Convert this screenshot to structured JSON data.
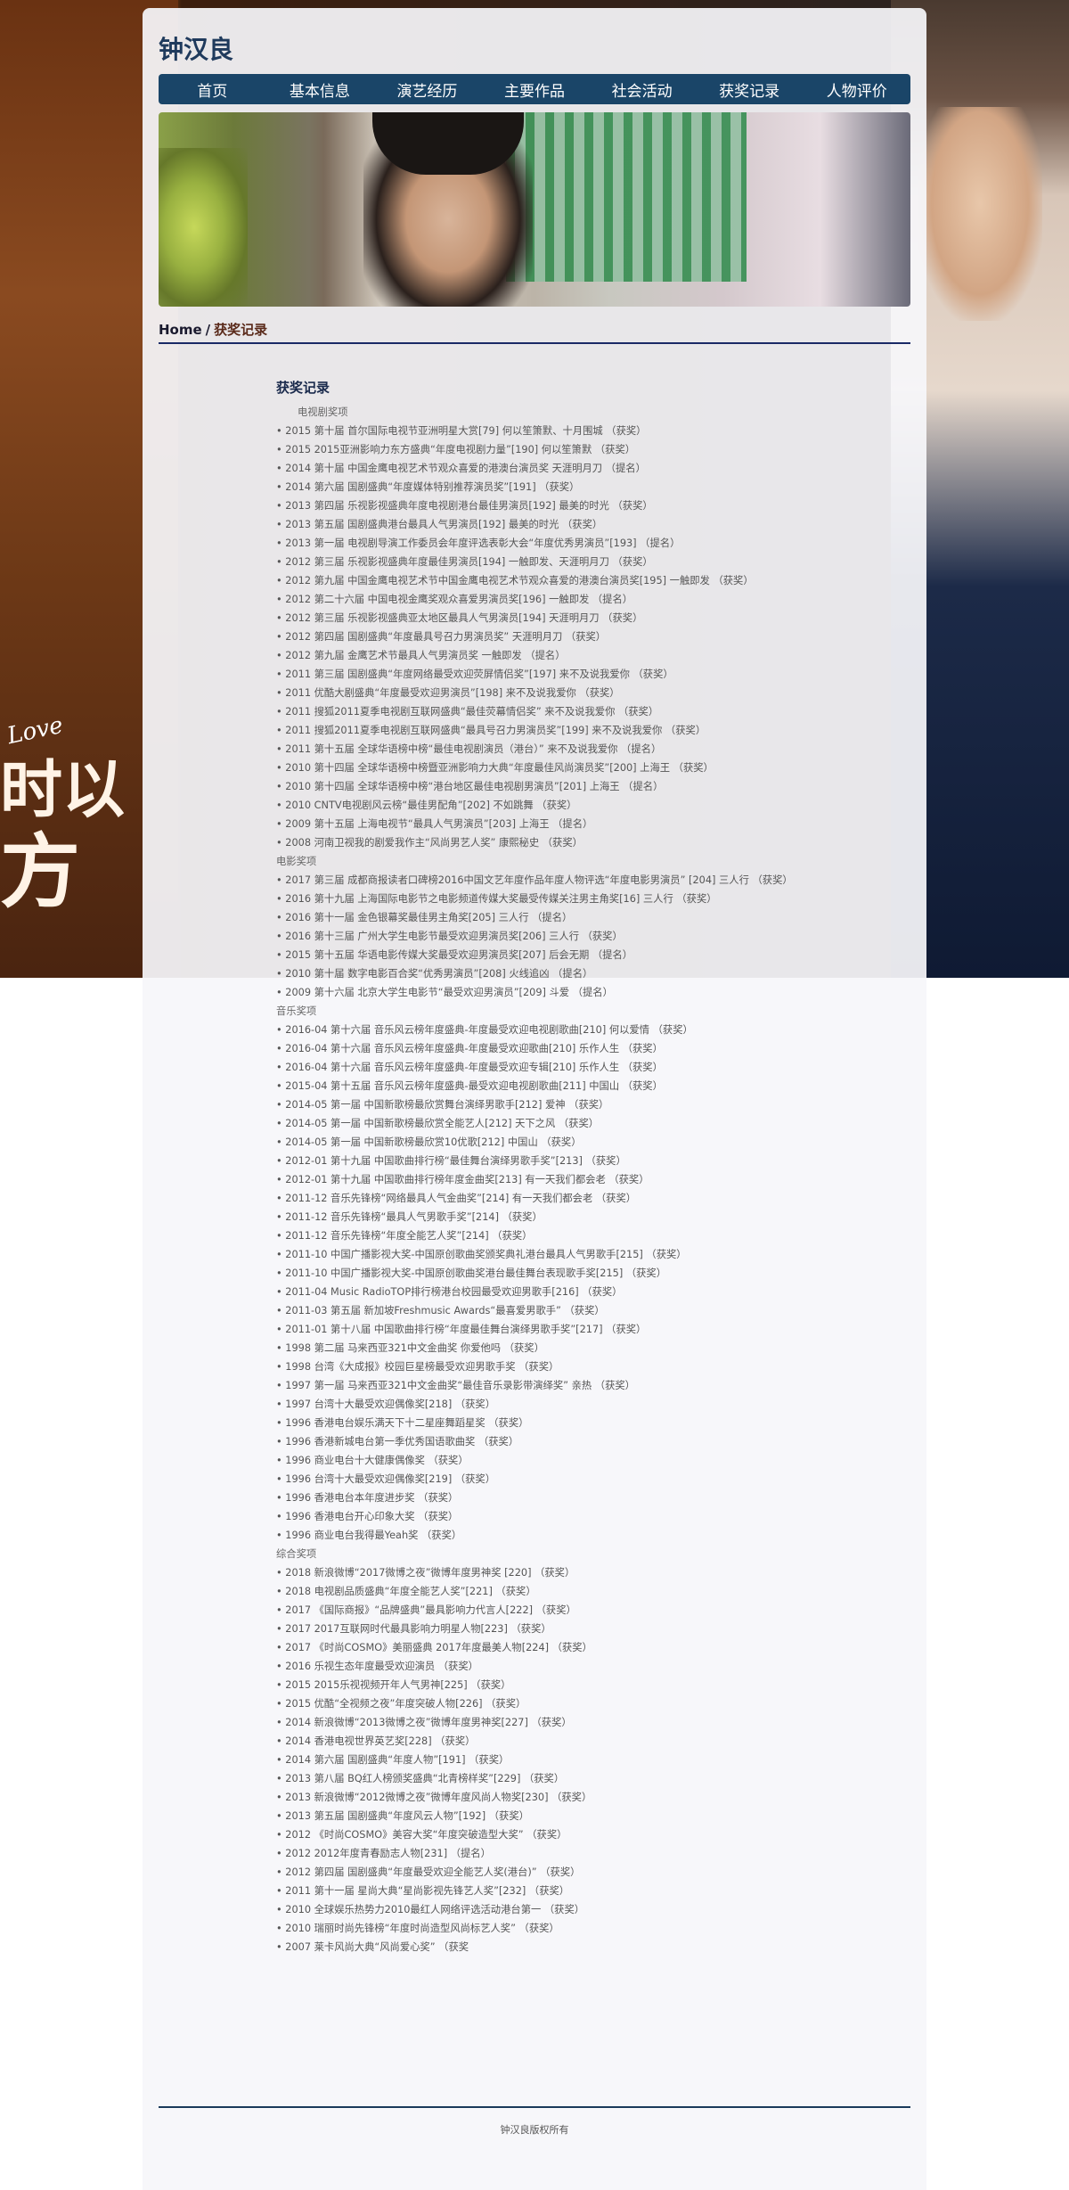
{
  "site": {
    "title": "钟汉良"
  },
  "nav": [
    "首页",
    "基本信息",
    "演艺经历",
    "主要作品",
    "社会活动",
    "获奖记录",
    "人物评价"
  ],
  "background": {
    "love_text": "Love",
    "big_char_1": "时以",
    "big_char_2": "方"
  },
  "breadcrumb": {
    "home": "Home",
    "sep": "/",
    "current": "获奖记录"
  },
  "section_title": "获奖记录",
  "categories": [
    {
      "name": "电视剧奖项",
      "indent": true,
      "items": [
        "2015 第十届 首尔国际电视节亚洲明星大赏[79] 何以笙箫默、十月围城 （获奖）",
        "2015 2015亚洲影响力东方盛典“年度电视剧力量”[190] 何以笙箫默 （获奖）",
        "2014 第十届 中国金鹰电视艺术节观众喜爱的港澳台演员奖 天涯明月刀 （提名）",
        "2014 第六届 国剧盛典“年度媒体特别推荐演员奖”[191] （获奖）",
        "2013 第四届 乐视影视盛典年度电视剧港台最佳男演员[192] 最美的时光 （获奖）",
        "2013 第五届 国剧盛典港台最具人气男演员[192] 最美的时光 （获奖）",
        "2013 第一届 电视剧导演工作委员会年度评选表彰大会“年度优秀男演员”[193] （提名）",
        "2012 第三届 乐视影视盛典年度最佳男演员[194] 一触即发、天涯明月刀 （获奖）",
        "2012 第九届 中国金鹰电视艺术节中国金鹰电视艺术节观众喜爱的港澳台演员奖[195] 一触即发 （获奖）",
        "2012 第二十六届 中国电视金鹰奖观众喜爱男演员奖[196] 一触即发 （提名）",
        "2012 第三届 乐视影视盛典亚太地区最具人气男演员[194] 天涯明月刀 （获奖）",
        "2012 第四届 国剧盛典“年度最具号召力男演员奖” 天涯明月刀 （获奖）",
        "2012 第九届 金鹰艺术节最具人气男演员奖 一触即发 （提名）",
        "2011 第三届 国剧盛典“年度网络最受欢迎荧屏情侣奖”[197] 来不及说我爱你 （获奖）",
        "2011 优酷大剧盛典“年度最受欢迎男演员”[198] 来不及说我爱你 （获奖）",
        "2011 搜狐2011夏季电视剧互联网盛典“最佳荧幕情侣奖” 来不及说我爱你 （获奖）",
        "2011 搜狐2011夏季电视剧互联网盛典“最具号召力男演员奖”[199] 来不及说我爱你 （获奖）",
        "2011 第十五届 全球华语榜中榜“最佳电视剧演员（港台）” 来不及说我爱你 （提名）",
        "2010 第十四届 全球华语榜中榜暨亚洲影响力大典“年度最佳风尚演员奖”[200] 上海王 （获奖）",
        "2010 第十四届 全球华语榜中榜“港台地区最佳电视剧男演员”[201] 上海王 （提名）",
        "2010 CNTV电视剧风云榜“最佳男配角”[202] 不如跳舞 （获奖）",
        "2009 第十五届 上海电视节“最具人气男演员”[203] 上海王 （提名）",
        "2008 河南卫视我的剧爱我作主“风尚男艺人奖” 康熙秘史 （获奖）"
      ]
    },
    {
      "name": "电影奖项",
      "indent": false,
      "items": [
        "2017 第三届 成都商报读者口碑榜2016中国文艺年度作品年度人物评选“年度电影男演员” [204] 三人行 （获奖）",
        "2016 第十九届 上海国际电影节之电影频道传媒大奖最受传媒关注男主角奖[16] 三人行 （获奖）",
        "2016 第十一届 金色银幕奖最佳男主角奖[205] 三人行 （提名）",
        "2016 第十三届 广州大学生电影节最受欢迎男演员奖[206] 三人行 （获奖）",
        "2015 第十五届 华语电影传媒大奖最受欢迎男演员奖[207] 后会无期 （提名）",
        "2010 第十届 数字电影百合奖“优秀男演员”[208] 火线追凶 （提名）",
        "2009 第十六届 北京大学生电影节“最受欢迎男演员”[209] 斗爱 （提名）"
      ]
    },
    {
      "name": "音乐奖项",
      "indent": false,
      "items": [
        "2016-04 第十六届 音乐风云榜年度盛典-年度最受欢迎电视剧歌曲[210] 何以爱情 （获奖）",
        "2016-04 第十六届 音乐风云榜年度盛典-年度最受欢迎歌曲[210] 乐作人生 （获奖）",
        "2016-04 第十六届 音乐风云榜年度盛典-年度最受欢迎专辑[210] 乐作人生 （获奖）",
        "2015-04 第十五届 音乐风云榜年度盛典-最受欢迎电视剧歌曲[211] 中国山 （获奖）",
        "2014-05 第一届 中国新歌榜最欣赏舞台演绎男歌手[212] 爱神 （获奖）",
        "2014-05 第一届 中国新歌榜最欣赏全能艺人[212] 天下之风 （获奖）",
        "2014-05 第一届 中国新歌榜最欣赏10优歌[212] 中国山 （获奖）",
        "2012-01 第十九届 中国歌曲排行榜“最佳舞台演绎男歌手奖”[213] （获奖）",
        "2012-01 第十九届 中国歌曲排行榜年度金曲奖[213] 有一天我们都会老 （获奖）",
        "2011-12 音乐先锋榜“网络最具人气金曲奖”[214] 有一天我们都会老 （获奖）",
        "2011-12 音乐先锋榜“最具人气男歌手奖”[214] （获奖）",
        "2011-12 音乐先锋榜“年度全能艺人奖”[214] （获奖）",
        "2011-10 中国广播影视大奖-中国原创歌曲奖颁奖典礼港台最具人气男歌手[215] （获奖）",
        "2011-10 中国广播影视大奖-中国原创歌曲奖港台最佳舞台表现歌手奖[215] （获奖）",
        "2011-04 Music RadioTOP排行榜港台校园最受欢迎男歌手[216] （获奖）",
        "2011-03 第五届 新加坡Freshmusic Awards“最喜爱男歌手” （获奖）",
        "2011-01 第十八届 中国歌曲排行榜“年度最佳舞台演绎男歌手奖”[217] （获奖）",
        "1998 第二届 马来西亚321中文金曲奖 你爱他吗 （获奖）",
        "1998 台湾《大成报》校园巨星榜最受欢迎男歌手奖 （获奖）",
        "1997 第一届 马来西亚321中文金曲奖“最佳音乐录影带演绎奖” 亲热 （获奖）",
        "1997 台湾十大最受欢迎偶像奖[218] （获奖）",
        "1996 香港电台娱乐满天下十二星座舞蹈星奖 （获奖）",
        "1996 香港新城电台第一季优秀国语歌曲奖 （获奖）",
        "1996 商业电台十大健康偶像奖 （获奖）",
        "1996 台湾十大最受欢迎偶像奖[219] （获奖）",
        "1996 香港电台本年度进步奖 （获奖）",
        "1996 香港电台开心印象大奖 （获奖）",
        "1996 商业电台我得最Yeah奖 （获奖）"
      ]
    },
    {
      "name": "综合奖项",
      "indent": false,
      "items": [
        "2018 新浪微博“2017微博之夜”微博年度男神奖 [220] （获奖）",
        "2018 电视剧品质盛典“年度全能艺人奖”[221] （获奖）",
        "2017 《国际商报》“品牌盛典”最具影响力代言人[222] （获奖）",
        "2017 2017互联网时代最具影响力明星人物[223] （获奖）",
        "2017 《时尚COSMO》美丽盛典 2017年度最美人物[224] （获奖）",
        "2016 乐视生态年度最受欢迎演员 （获奖）",
        "2015 2015乐视视频开年人气男神[225] （获奖）",
        "2015 优酷“全视频之夜”年度突破人物[226] （获奖）",
        "2014 新浪微博“2013微博之夜”微博年度男神奖[227] （获奖）",
        "2014 香港电视世界英艺奖[228] （获奖）",
        "2014 第六届 国剧盛典“年度人物”[191] （获奖）",
        "2013 第八届 BQ红人榜颁奖盛典“北青榜样奖”[229] （获奖）",
        "2013 新浪微博“2012微博之夜”微博年度风尚人物奖[230] （获奖）",
        "2013 第五届 国剧盛典“年度风云人物”[192] （获奖）",
        "2012 《时尚COSMO》美容大奖“年度突破造型大奖” （获奖）",
        "2012 2012年度青春励志人物[231] （提名）",
        "2012 第四届 国剧盛典“年度最受欢迎全能艺人奖(港台)” （获奖）",
        "2011 第十一届 星尚大典“星尚影视先锋艺人奖”[232] （获奖）",
        "2010 全球娱乐热势力2010最红人网络评选活动港台第一 （获奖）",
        "2010 瑞丽时尚先锋榜“年度时尚造型风尚标艺人奖” （获奖）",
        "2007 莱卡风尚大典“风尚爱心奖” （获奖"
      ]
    }
  ],
  "footer": {
    "text": "钟汉良版权所有"
  }
}
